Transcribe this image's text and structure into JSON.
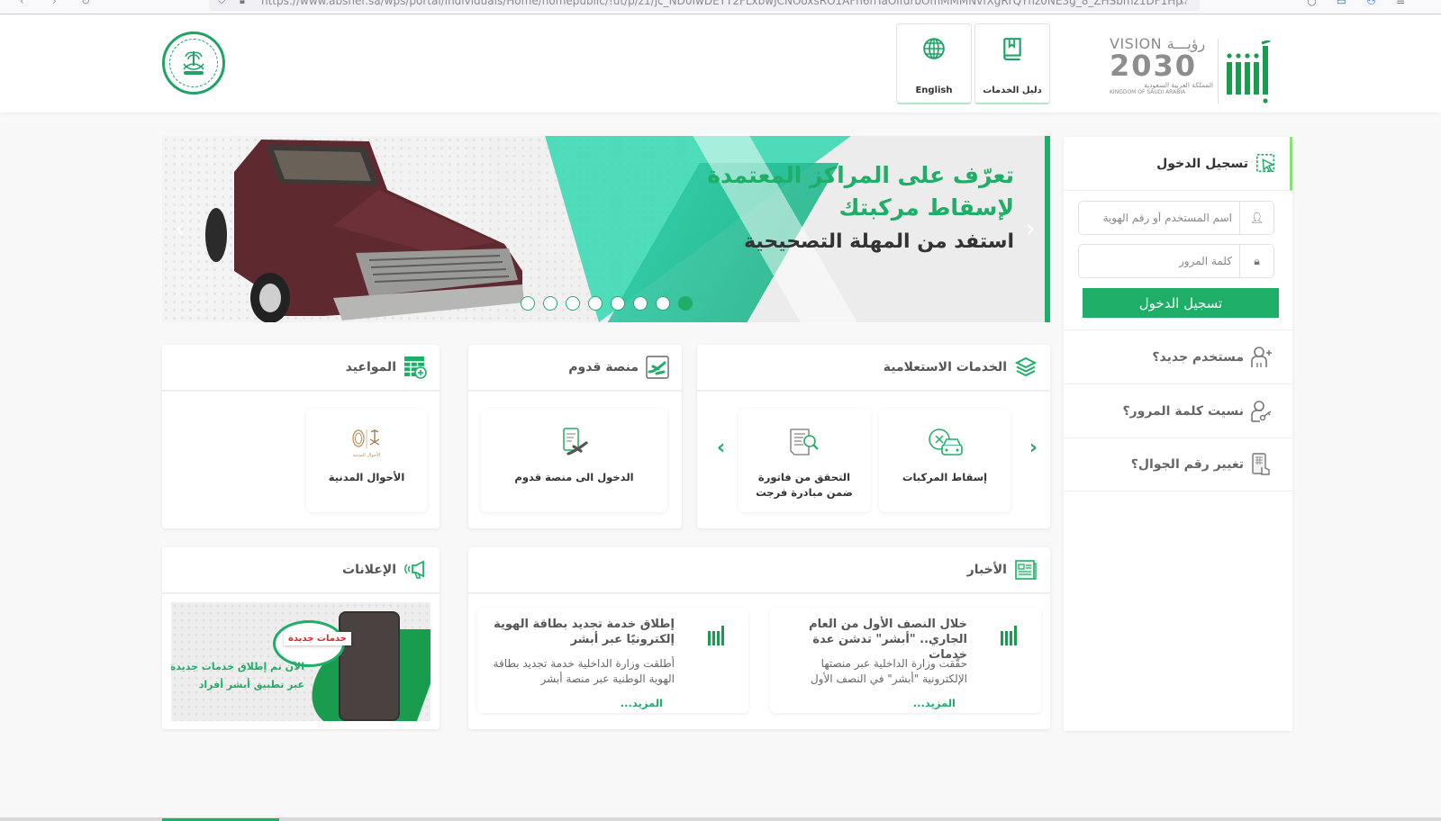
{
  "browser": {
    "url": "https://www.absher.sa/wps/portal/individuals/Home/homepublic/!ut/p/z1/jc_ND0IwDEYT2FLxbwJCNOoxsRO1AFn6hTaOlfdrbOmMMMNvfXgRrQYnz0NE3g_8_ZHSbmz1DF1Hp"
  },
  "header": {
    "english_label": "English",
    "guide_label": "دليل الخدمات",
    "vision": {
      "line1": "VISION رؤيـــة",
      "year": "2030",
      "arabic_country": "المملكة العربية السعودية",
      "english_country": "KINGDOM OF SAUDI ARABIA"
    },
    "brand_color": "#1fae68"
  },
  "banner": {
    "line1": "تعرّف على المراكز المعتمدة",
    "line2": "لإسقاط مركبتك",
    "line3": "استفد من المهلة التصحيحية",
    "slide_count": 8,
    "active_slide": 8
  },
  "login": {
    "title": "تسجيل الدخول",
    "username_placeholder": "اسم المستخدم أو رقم الهوية",
    "password_placeholder": "كلمة المرور",
    "submit_label": "تسجيل الدخول",
    "links": [
      {
        "label": "مستخدم جديد؟",
        "icon": "user-plus-icon"
      },
      {
        "label": "نسيت كلمة المرور؟",
        "icon": "user-key-icon"
      },
      {
        "label": "تغيير رقم الجوال؟",
        "icon": "mobile-touch-icon"
      }
    ]
  },
  "inquiry_services": {
    "title": "الخدمات الاستعلامية",
    "items": [
      {
        "label": "إسقاط المركبات",
        "icon": "car-remove-icon"
      },
      {
        "label": "التحقق من فاتورة ضمن مبادرة فرجت",
        "icon": "invoice-search-icon"
      }
    ]
  },
  "arrival_platform": {
    "title": "منصة قدوم",
    "items": [
      {
        "label": "الدخول الى منصة قدوم",
        "icon": "arrival-checklist-icon"
      }
    ]
  },
  "appointments": {
    "title": "المواعيد",
    "items": [
      {
        "label": "الأحوال المدنية",
        "icon": "civil-affairs-logo",
        "logo_caption": "الأحوال المدنية"
      }
    ]
  },
  "news": {
    "title": "الأخبار",
    "more_label": "المزيد...",
    "items": [
      {
        "title": "خلال النصف الأول من العام الجاري.. \"أبشر\" تدشن عدة خدمات",
        "body": "حقّقت وزارة الداخلية عبر منصتها الإلكترونية \"أبشر\" في النصف الأول"
      },
      {
        "title": "إطلاق خدمة تجديد بطاقة الهوية إلكترونيًا عبر أبشر",
        "body": "أطلقت وزارة الداخلية خدمة تجديد بطاقة الهوية الوطنية عبر منصة أبشر"
      }
    ]
  },
  "announcements": {
    "title": "الإعلانات",
    "badge": "خدمات جديدة",
    "line1": "الآن تم إطلاق خدمات جديدة",
    "line2": "عبر تطبيق أبشر أفراد"
  }
}
